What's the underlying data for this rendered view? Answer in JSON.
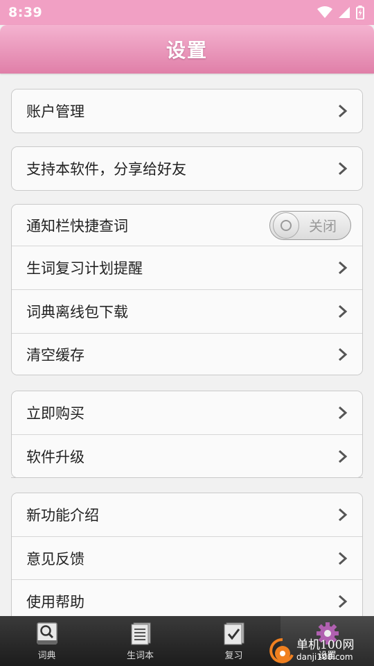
{
  "status_bar": {
    "time": "8:39"
  },
  "header": {
    "title": "设置"
  },
  "groups": [
    {
      "items": [
        {
          "label": "账户管理"
        }
      ]
    },
    {
      "items": [
        {
          "label": "支持本软件，分享给好友"
        }
      ]
    },
    {
      "items": [
        {
          "label": "通知栏快捷查词",
          "toggle": {
            "state_label": "关闭",
            "on": false
          }
        },
        {
          "label": "生词复习计划提醒"
        },
        {
          "label": "词典离线包下载"
        },
        {
          "label": "清空缓存"
        }
      ]
    },
    {
      "items": [
        {
          "label": "立即购买"
        },
        {
          "label": "软件升级"
        }
      ]
    },
    {
      "items": [
        {
          "label": "新功能介绍"
        },
        {
          "label": "意见反馈"
        },
        {
          "label": "使用帮助"
        }
      ]
    }
  ],
  "tabs": [
    {
      "label": "词典",
      "icon": "magnifier-book-icon"
    },
    {
      "label": "生词本",
      "icon": "notebook-icon"
    },
    {
      "label": "复习",
      "icon": "checklist-icon"
    },
    {
      "label": "设置",
      "icon": "gear-icon",
      "active": true
    }
  ],
  "watermark": {
    "text": "单机100网",
    "subtext": "danji100.com"
  },
  "colors": {
    "accent": "#e07fa8",
    "status_bar": "#f1a0c4"
  }
}
